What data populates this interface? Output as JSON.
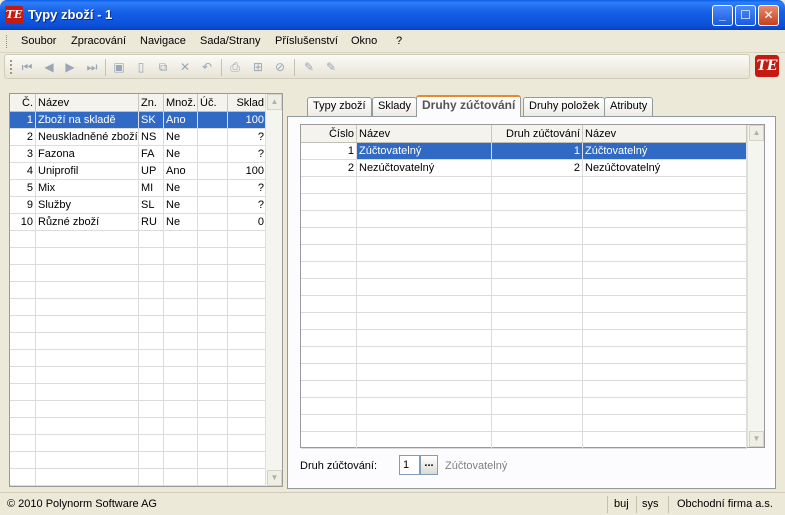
{
  "window": {
    "title": "Typy zboží - 1",
    "app_icon": "TE",
    "minimize_glyph": "_",
    "maximize_glyph": "☐",
    "close_glyph": "✕"
  },
  "menu": [
    "Soubor",
    "Zpracování",
    "Navigace",
    "Sada/Strany",
    "Příslušenství",
    "Okno",
    "?"
  ],
  "toolbar": {
    "icons": [
      "first-record-icon",
      "prev-record-icon",
      "next-record-icon",
      "last-record-icon",
      "save-icon",
      "new-icon",
      "copy-icon",
      "delete-icon",
      "undo-icon",
      "print-icon",
      "tree-icon",
      "cancel-icon",
      "edit-icon",
      "edit-alt-icon"
    ],
    "logo": "TE"
  },
  "left_grid": {
    "columns": [
      "Č.",
      "Název",
      "Zn.",
      "Množ.",
      "Úč.",
      "Sklad"
    ],
    "rows": [
      {
        "no": "1",
        "name": "Zboží na skladě",
        "code": "SK",
        "qty": "Ano",
        "acc": "",
        "stock": "100"
      },
      {
        "no": "2",
        "name": "Neuskladněné zboží",
        "code": "NS",
        "qty": "Ne",
        "acc": "",
        "stock": "?"
      },
      {
        "no": "3",
        "name": "Fazona",
        "code": "FA",
        "qty": "Ne",
        "acc": "",
        "stock": "?"
      },
      {
        "no": "4",
        "name": "Uniprofil",
        "code": "UP",
        "qty": "Ano",
        "acc": "",
        "stock": "100"
      },
      {
        "no": "5",
        "name": "Mix",
        "code": "MI",
        "qty": "Ne",
        "acc": "",
        "stock": "?"
      },
      {
        "no": "9",
        "name": "Služby",
        "code": "SL",
        "qty": "Ne",
        "acc": "",
        "stock": "?"
      },
      {
        "no": "10",
        "name": "Různé zboží",
        "code": "RU",
        "qty": "Ne",
        "acc": "",
        "stock": "0"
      }
    ],
    "selected_index": 0
  },
  "tabs": [
    {
      "label": "Typy zboží",
      "active": false
    },
    {
      "label": "Sklady",
      "active": false
    },
    {
      "label": "Druhy zúčtování",
      "active": true
    },
    {
      "label": "Druhy položek",
      "active": false
    },
    {
      "label": "Atributy",
      "active": false
    }
  ],
  "right_grid": {
    "columns": [
      "Číslo",
      "Název",
      "Druh zúčtování",
      "Název"
    ],
    "rows": [
      {
        "no": "1",
        "name": "Zúčtovatelný",
        "type": "1",
        "type_name": "Zúčtovatelný"
      },
      {
        "no": "2",
        "name": "Nezúčtovatelný",
        "type": "2",
        "type_name": "Nezúčtovatelný"
      }
    ],
    "selected_index": 0
  },
  "form": {
    "label": "Druh zúčtování:",
    "value": "1",
    "button": "...",
    "value_name": "Zúčtovatelný"
  },
  "status": {
    "copyright": "© 2010 Polynorm Software AG",
    "user": "buj",
    "db": "sys",
    "firm": "Obchodní firma a.s."
  }
}
